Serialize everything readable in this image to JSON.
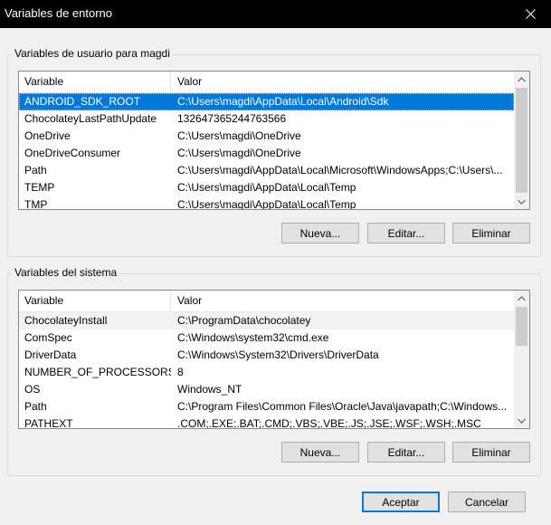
{
  "window": {
    "title": "Variables de entorno"
  },
  "user_group": {
    "label": "Variables de usuario para magdi",
    "columns": [
      "Variable",
      "Valor"
    ],
    "rows": [
      [
        "ANDROID_SDK_ROOT",
        "C:\\Users\\magdi\\AppData\\Local\\Android\\Sdk"
      ],
      [
        "ChocolateyLastPathUpdate",
        "132647365244763566"
      ],
      [
        "OneDrive",
        "C:\\Users\\magdi\\OneDrive"
      ],
      [
        "OneDriveConsumer",
        "C:\\Users\\magdi\\OneDrive"
      ],
      [
        "Path",
        "C:\\Users\\magdi\\AppData\\Local\\Microsoft\\WindowsApps;C:\\Users\\..."
      ],
      [
        "TEMP",
        "C:\\Users\\magdi\\AppData\\Local\\Temp"
      ],
      [
        "TMP",
        "C:\\Users\\magdi\\AppData\\Local\\Temp"
      ]
    ],
    "buttons": {
      "new": "Nueva...",
      "edit": "Editar...",
      "delete": "Eliminar"
    }
  },
  "system_group": {
    "label": "Variables del sistema",
    "columns": [
      "Variable",
      "Valor"
    ],
    "rows": [
      [
        "ChocolateyInstall",
        "C:\\ProgramData\\chocolatey"
      ],
      [
        "ComSpec",
        "C:\\Windows\\system32\\cmd.exe"
      ],
      [
        "DriverData",
        "C:\\Windows\\System32\\Drivers\\DriverData"
      ],
      [
        "NUMBER_OF_PROCESSORS",
        "8"
      ],
      [
        "OS",
        "Windows_NT"
      ],
      [
        "Path",
        "C:\\Program Files\\Common Files\\Oracle\\Java\\javapath;C:\\Windows..."
      ],
      [
        "PATHEXT",
        ".COM;.EXE;.BAT;.CMD;.VBS;.VBE;.JS;.JSE;.WSF;.WSH;.MSC"
      ]
    ],
    "buttons": {
      "new": "Nueva...",
      "edit": "Editar...",
      "delete": "Eliminar"
    }
  },
  "dialog_buttons": {
    "ok": "Aceptar",
    "cancel": "Cancelar"
  },
  "colors": {
    "selection": "#0078d7",
    "titlebar": "#000000",
    "background": "#f0f0f0"
  },
  "icons": {
    "close": "close-icon",
    "scroll_up": "chevron-up-icon",
    "scroll_down": "chevron-down-icon"
  }
}
